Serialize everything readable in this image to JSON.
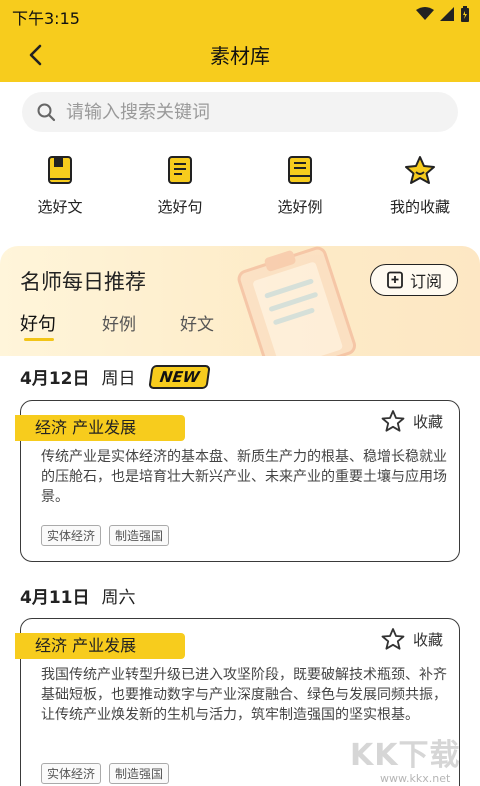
{
  "status_bar": {
    "time": "下午3:15"
  },
  "header": {
    "title": "素材库"
  },
  "search": {
    "placeholder": "请输入搜索关键词"
  },
  "quick_actions": [
    {
      "label": "选好文",
      "icon": "book-icon"
    },
    {
      "label": "选好句",
      "icon": "notebook-icon"
    },
    {
      "label": "选好例",
      "icon": "document-icon"
    },
    {
      "label": "我的收藏",
      "icon": "star-icon"
    }
  ],
  "recommend": {
    "title": "名师每日推荐",
    "subscribe_label": "订阅",
    "tabs": [
      "好句",
      "好例",
      "好文"
    ],
    "active_tab": "好句"
  },
  "days": [
    {
      "date": "4月12日",
      "weekday": "周日",
      "badge": "NEW",
      "card": {
        "tag": "经济  产业发展",
        "fav_label": "收藏",
        "text": "传统产业是实体经济的基本盘、新质生产力的根基、稳增长稳就业的压舱石，也是培育壮大新兴产业、未来产业的重要土壤与应用场景。",
        "chips": [
          "实体经济",
          "制造强国"
        ]
      }
    },
    {
      "date": "4月11日",
      "weekday": "周六",
      "badge": "",
      "card": {
        "tag": "经济  产业发展",
        "fav_label": "收藏",
        "text": "我国传统产业转型升级已进入攻坚阶段，既要破解技术瓶颈、补齐基础短板，也要推动数字与产业深度融合、绿色与发展同频共振，让传统产业焕发新的生机与活力，筑牢制造强国的坚实根基。",
        "chips": [
          "实体经济",
          "制造强国"
        ]
      }
    }
  ],
  "watermark": {
    "brand": "KK下载",
    "url": "www.kkx.net"
  },
  "colors": {
    "accent": "#f7cc1d",
    "recommend_bg": "#fdebc7"
  }
}
